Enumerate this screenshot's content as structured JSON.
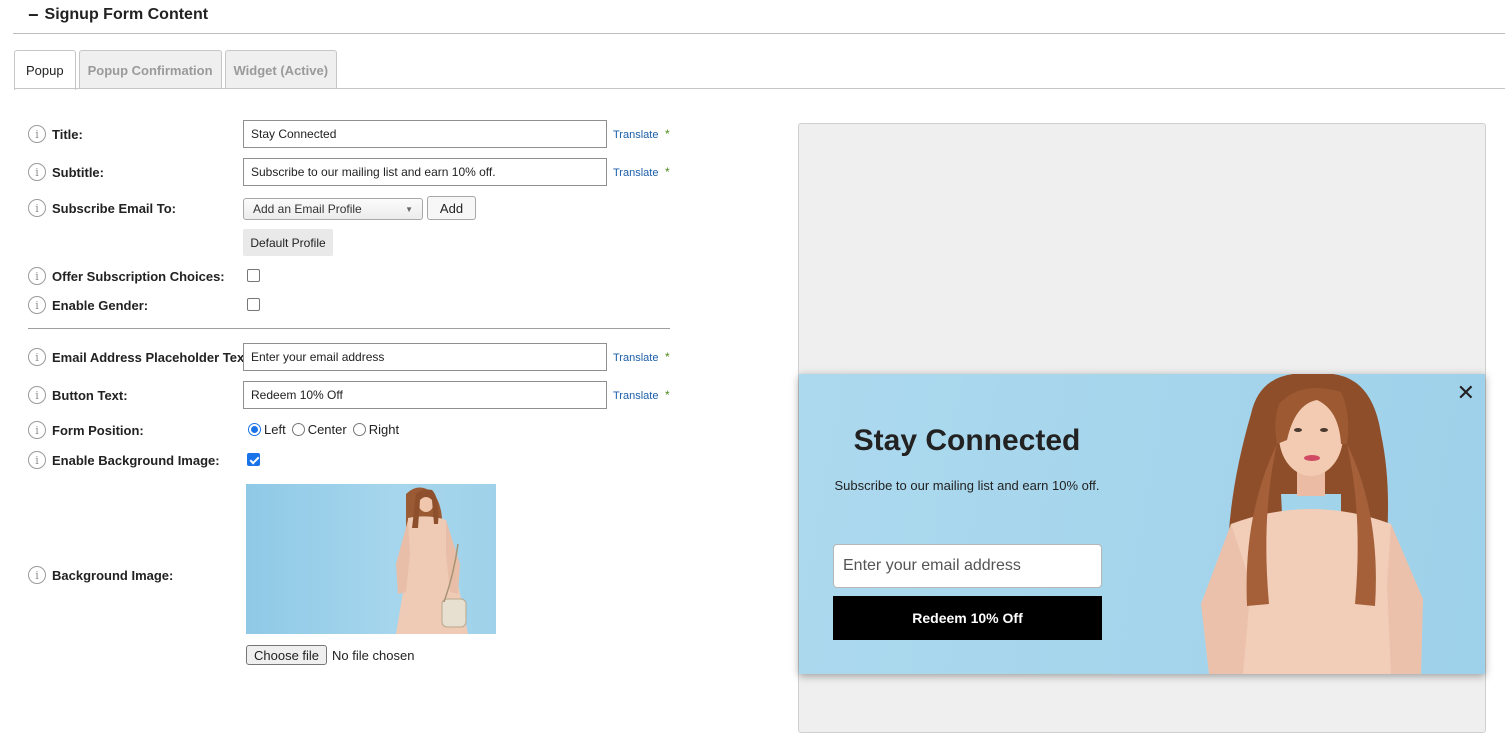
{
  "section": {
    "title": "Signup Form Content"
  },
  "tabs": [
    {
      "label": "Popup",
      "active": true
    },
    {
      "label": "Popup Confirmation",
      "active": false
    },
    {
      "label": "Widget (Active)",
      "active": false
    }
  ],
  "form": {
    "translate_label": "Translate",
    "required_mark": "*",
    "title_label": "Title:",
    "title_value": "Stay Connected",
    "subtitle_label": "Subtitle:",
    "subtitle_value": "Subscribe to our mailing list and earn 10% off.",
    "subscribe_label": "Subscribe Email To:",
    "subscribe_select": "Add an Email Profile",
    "add_button": "Add",
    "default_profile": "Default Profile",
    "offer_choices_label": "Offer Subscription Choices:",
    "offer_choices_checked": false,
    "enable_gender_label": "Enable Gender:",
    "enable_gender_checked": false,
    "email_placeholder_label": "Email Address Placeholder Text:",
    "email_placeholder_value": "Enter your email address",
    "button_text_label": "Button Text:",
    "button_text_value": "Redeem 10% Off",
    "form_position_label": "Form Position:",
    "position_options": [
      "Left",
      "Center",
      "Right"
    ],
    "position_selected": "Left",
    "enable_bg_label": "Enable Background Image:",
    "enable_bg_checked": true,
    "bg_image_label": "Background Image:",
    "choose_file": "Choose file",
    "no_file": "No file chosen"
  },
  "preview": {
    "title": "Stay Connected",
    "subtitle": "Subscribe to our mailing list and earn 10% off.",
    "email_placeholder": "Enter your email address",
    "button": "Redeem 10% Off",
    "close_glyph": "✕"
  },
  "colors": {
    "link": "#1b5fa8",
    "required": "#4d8a1e",
    "checkbox": "#1a73e8",
    "popup_bg": "#a4d5ec",
    "popup_button": "#000000"
  },
  "icons": [
    "minus-icon",
    "info-icon",
    "chevron-down-icon",
    "close-icon"
  ]
}
